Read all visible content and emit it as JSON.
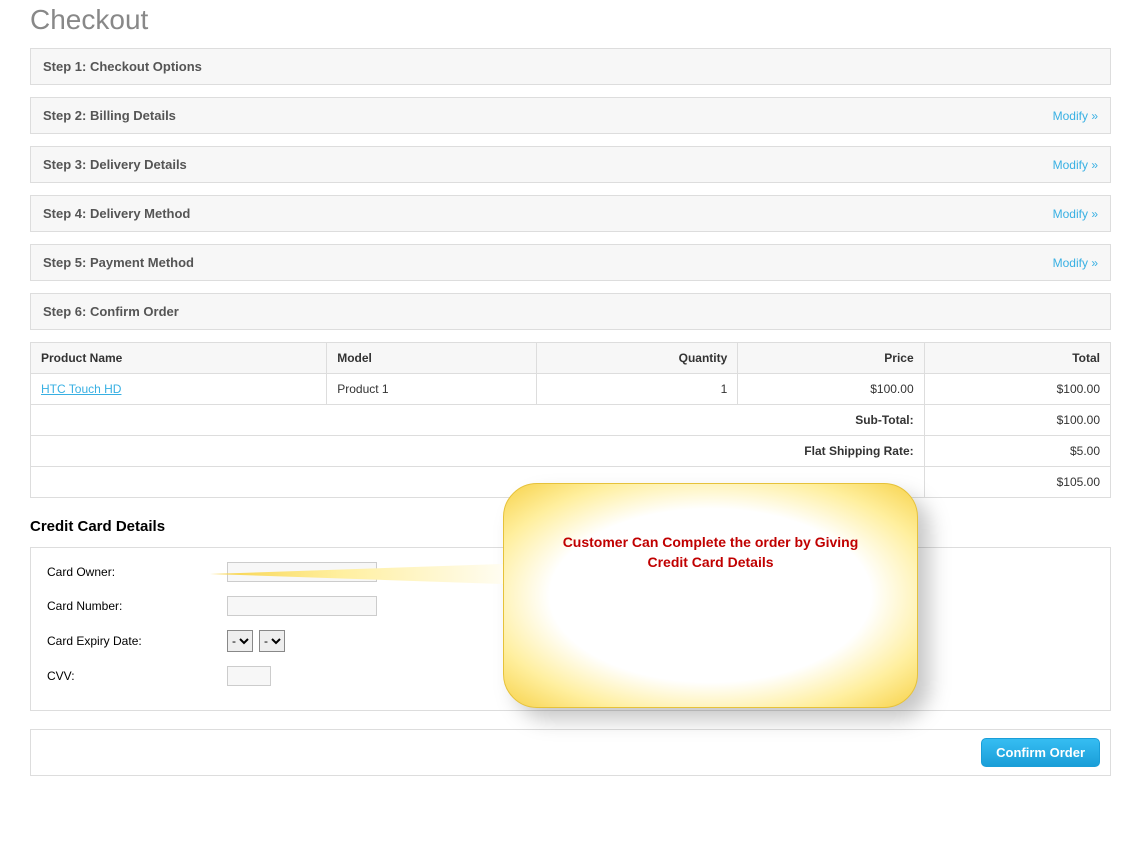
{
  "page_title": "Checkout",
  "modify_label": "Modify »",
  "steps": {
    "s1": "Step 1: Checkout Options",
    "s2": "Step 2: Billing Details",
    "s3": "Step 3: Delivery Details",
    "s4": "Step 4: Delivery Method",
    "s5": "Step 5: Payment Method",
    "s6": "Step 6: Confirm Order"
  },
  "table_headers": {
    "product": "Product Name",
    "model": "Model",
    "qty": "Quantity",
    "price": "Price",
    "total": "Total"
  },
  "order_rows": [
    {
      "product": "HTC Touch HD",
      "model": "Product 1",
      "qty": "1",
      "price": "$100.00",
      "total": "$100.00"
    }
  ],
  "summary": {
    "subtotal_label": "Sub-Total:",
    "subtotal_value": "$100.00",
    "shipping_label": "Flat Shipping Rate:",
    "shipping_value": "$5.00",
    "grand_value": "$105.00"
  },
  "cc_heading": "Credit Card Details",
  "cc": {
    "owner_label": "Card Owner:",
    "number_label": "Card Number:",
    "expiry_label": "Card Expiry Date:",
    "cvv_label": "CVV:",
    "month_value": "-",
    "year_value": "-",
    "owner_value": "",
    "number_value": "",
    "cvv_value": ""
  },
  "confirm_label": "Confirm Order",
  "callout_text": "Customer Can Complete the order by Giving Credit Card Details"
}
